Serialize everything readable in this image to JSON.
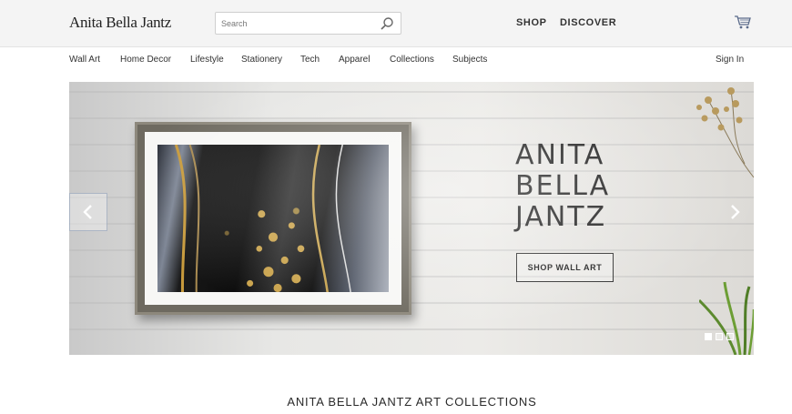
{
  "header": {
    "brand": "Anita Bella Jantz",
    "search_placeholder": "Search",
    "nav": [
      "SHOP",
      "DISCOVER"
    ]
  },
  "categories": [
    "Wall Art",
    "Home Decor",
    "Lifestyle",
    "Stationery",
    "Tech",
    "Apparel",
    "Collections",
    "Subjects"
  ],
  "account": {
    "signin_label": "Sign In"
  },
  "hero": {
    "title_lines": [
      "ANITA",
      "BELLA",
      "JANTZ"
    ],
    "cta_label": "SHOP WALL ART",
    "slide_count": 3,
    "active_slide": 1
  },
  "section": {
    "title": "ANITA BELLA JANTZ ART COLLECTIONS"
  },
  "icons": {
    "search": "search-icon",
    "cart": "cart-icon",
    "prev": "chevron-left-icon",
    "next": "chevron-right-icon"
  },
  "colors": {
    "topbar": "#f4f4f4",
    "text": "#333333"
  }
}
